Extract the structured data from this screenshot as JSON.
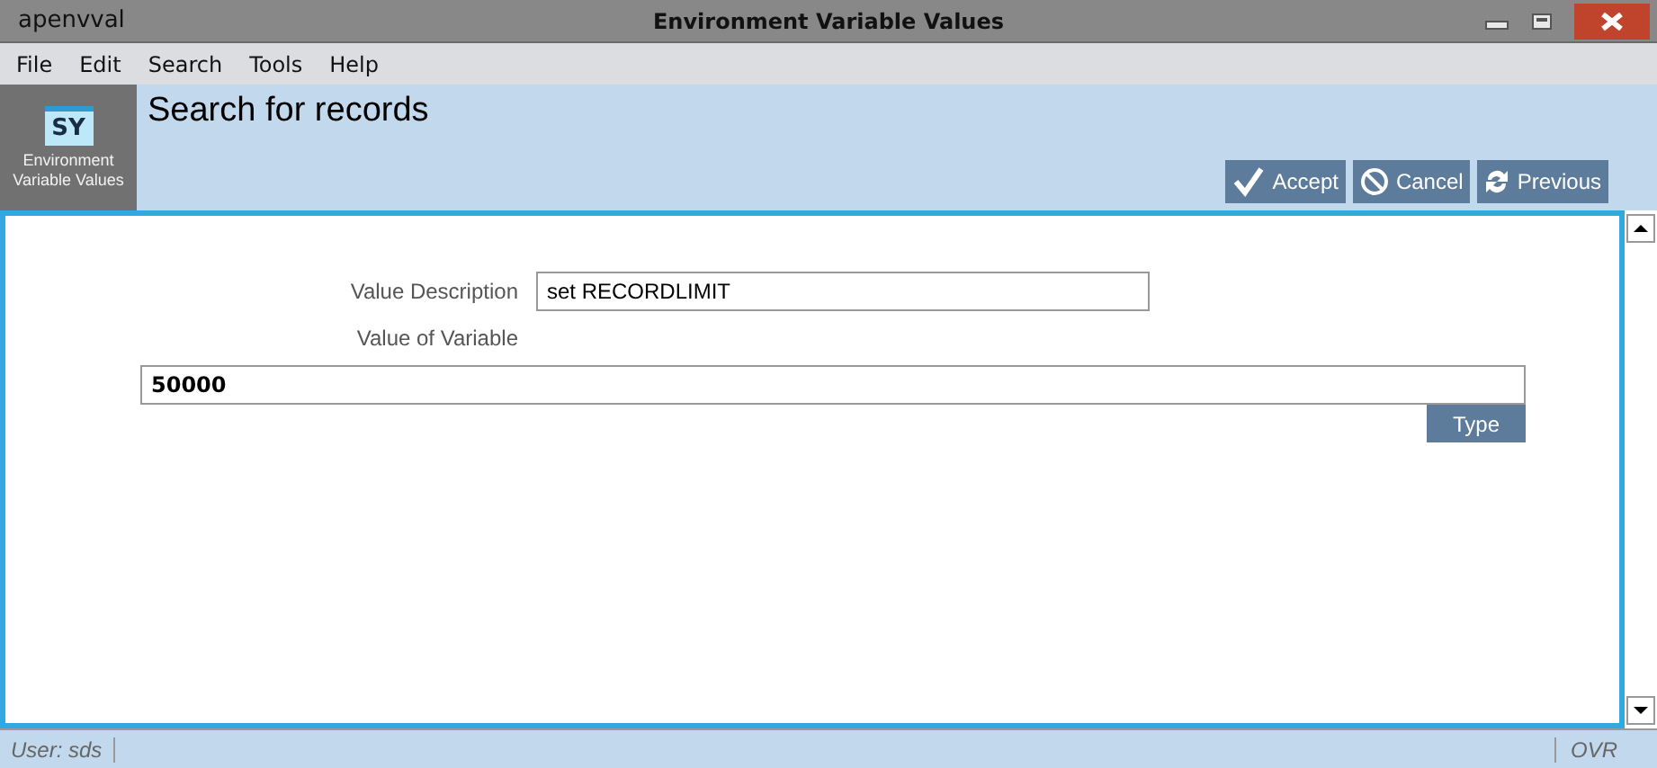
{
  "window": {
    "app_name": "apenvval",
    "title": "Environment Variable Values"
  },
  "menu": [
    "File",
    "Edit",
    "Search",
    "Tools",
    "Help"
  ],
  "module": {
    "badge": "SY",
    "label": "Environment Variable Values"
  },
  "heading": "Search for records",
  "actions": [
    {
      "kind": "accept",
      "label": "Accept"
    },
    {
      "kind": "cancel",
      "label": "Cancel"
    },
    {
      "kind": "previous",
      "label": "Previous"
    }
  ],
  "form": {
    "description_label": "Value Description",
    "description_value": "set RECORDLIMIT",
    "variable_label": "Value of Variable",
    "variable_value": "50000",
    "type_button": "Type"
  },
  "status_bar": {
    "user": "User: sds",
    "mode": "OVR"
  }
}
